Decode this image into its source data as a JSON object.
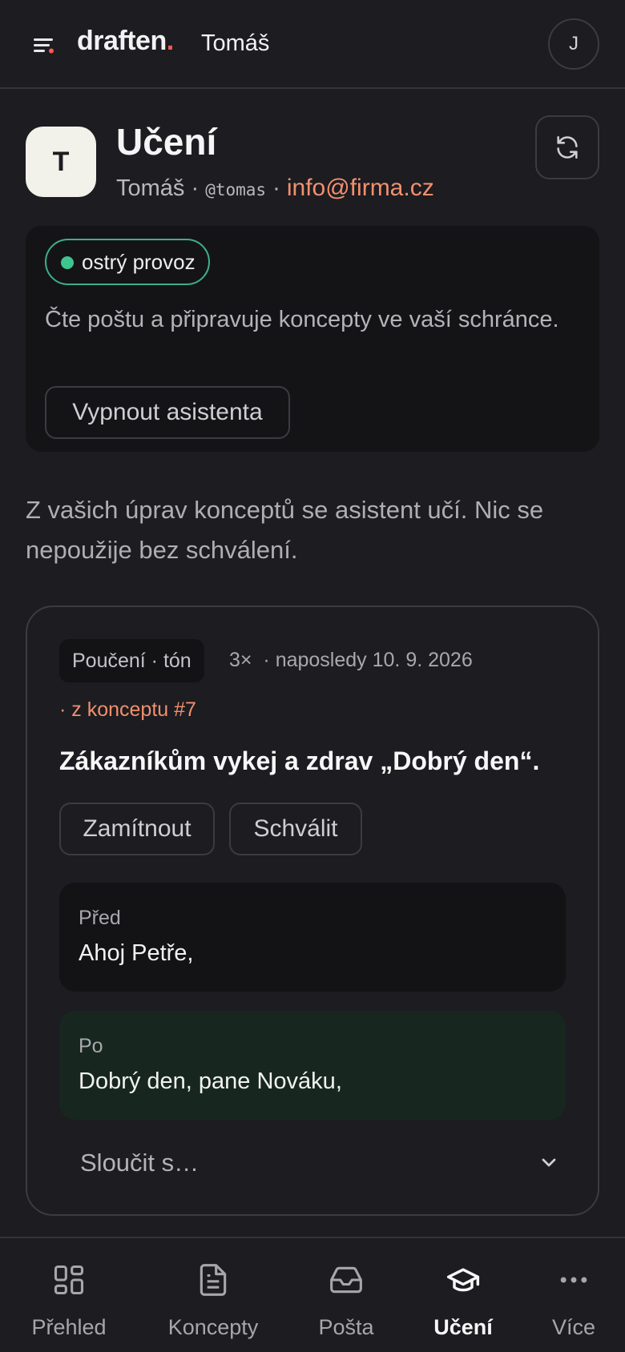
{
  "topbar": {
    "logo_text": "draften",
    "logo_dot": ".",
    "org_name": "Tomáš",
    "user_initial": "J"
  },
  "header": {
    "avatar_initial": "T",
    "title": "Učení",
    "name": "Tomáš",
    "sep1": "·",
    "handle": "@tomas",
    "sep2": "·",
    "email": "info@firma.cz"
  },
  "status": {
    "badge": "ostrý provoz",
    "badge_color": "#3fc58f",
    "description": "Čte poštu a připravuje koncepty ve vaší schránce.",
    "disable_label": "Vypnout asistenta"
  },
  "intro": "Z vašich úprav konceptů se asistent učí. Nic se nepoužije bez schválení.",
  "lesson": {
    "tag": "Poučení · tón",
    "count": "3×",
    "last_seen": "· naposledy 10. 9. 2026",
    "source": "· z konceptu #7",
    "rule": "Zákazníkům vykej a zdrav „Dobrý den“.",
    "reject_label": "Zamítnout",
    "approve_label": "Schválit",
    "before_label": "Před",
    "before_text": "Ahoj Petře,",
    "after_label": "Po",
    "after_text": "Dobrý den, pane Nováku,",
    "merge_label": "Sloučit s…"
  },
  "nav": {
    "items": [
      {
        "label": "Přehled",
        "icon": "grid-icon"
      },
      {
        "label": "Koncepty",
        "icon": "document-icon"
      },
      {
        "label": "Pošta",
        "icon": "inbox-icon"
      },
      {
        "label": "Učení",
        "icon": "graduation-cap-icon",
        "active": true
      },
      {
        "label": "Více",
        "icon": "more-icon"
      }
    ]
  },
  "colors": {
    "accent": "#f2906d",
    "logo_dot": "#ff5a4e",
    "live": "#3fc58f",
    "background": "#1c1c21"
  }
}
